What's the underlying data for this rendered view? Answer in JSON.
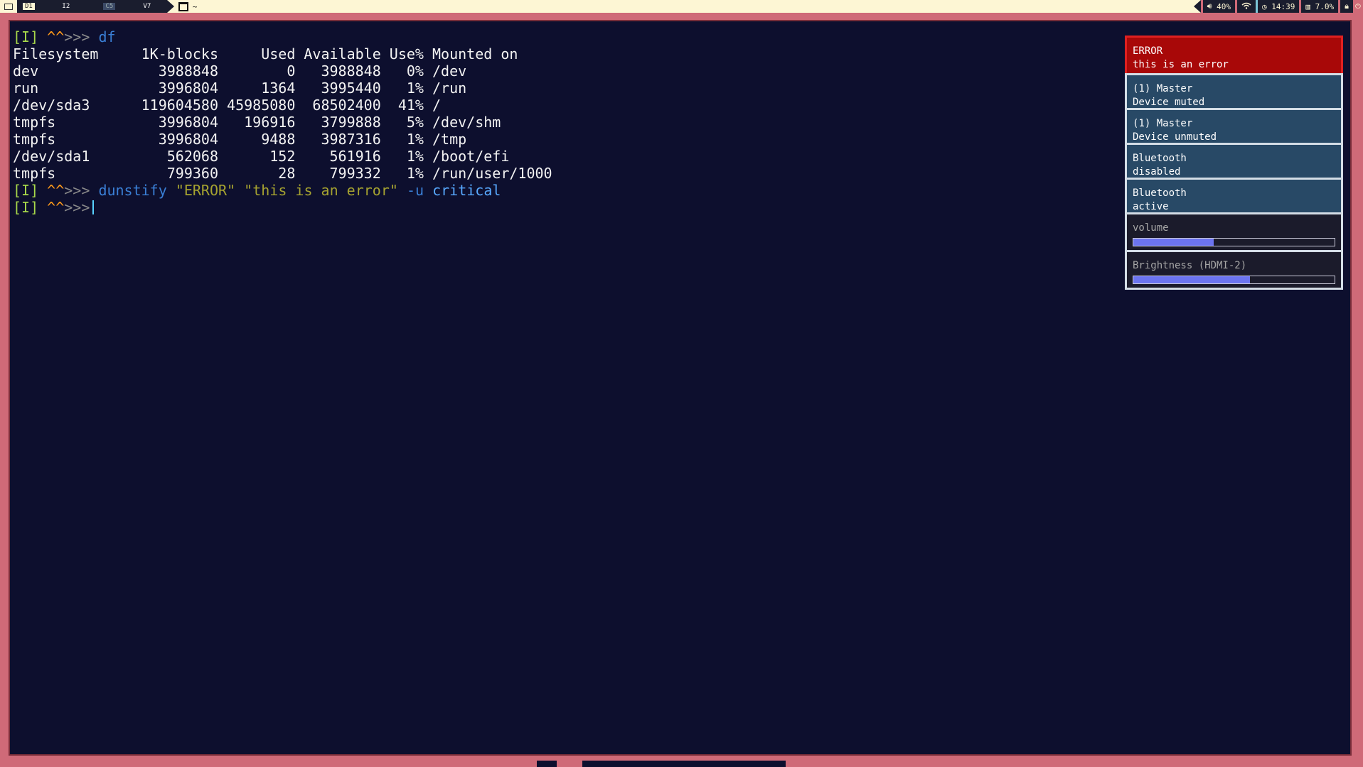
{
  "topbar": {
    "workspaces": [
      {
        "label": "D1",
        "active": true
      },
      {
        "label": "I2",
        "active": false
      },
      {
        "label": "C5",
        "active": false
      },
      {
        "label": "V7",
        "active": false
      }
    ],
    "window_title": "~",
    "status": {
      "volume": "40%",
      "time": "14:39",
      "cpu": "7.0%"
    },
    "icons": {
      "layout": "layout-icon",
      "window": "window-icon",
      "volume": "speaker-icon",
      "wifi": "wifi-icon",
      "clock": "clock-icon",
      "cpu": "cpu-icon",
      "lock": "lock-icon",
      "power": "power-icon"
    }
  },
  "terminal": {
    "prompt": {
      "mode": "[I]",
      "carets": "^^",
      "arrows": ">>>"
    },
    "command1": "df",
    "df": {
      "header": "Filesystem     1K-blocks     Used Available Use% Mounted on",
      "rows": [
        "dev              3988848        0   3988848   0% /dev",
        "run              3996804     1364   3995440   1% /run",
        "/dev/sda3      119604580 45985080  68502400  41% /",
        "tmpfs            3996804   196916   3799888   5% /dev/shm",
        "tmpfs            3996804     9488   3987316   1% /tmp",
        "/dev/sda1         562068      152    561916   1% /boot/efi",
        "tmpfs             799360       28    799332   1% /run/user/1000"
      ]
    },
    "command2": {
      "cmd": "dunstify",
      "arg1": "\"ERROR\"",
      "arg2": "\"this is an error\"",
      "flag": "-u",
      "value": "critical"
    }
  },
  "notifications": [
    {
      "urgency": "critical",
      "summary": "ERROR",
      "body": "this is an error"
    },
    {
      "urgency": "normal",
      "summary": "(1) Master",
      "body": "Device muted"
    },
    {
      "urgency": "normal",
      "summary": "(1) Master",
      "body": "Device unmuted"
    },
    {
      "urgency": "normal",
      "summary": "Bluetooth",
      "body": "disabled"
    },
    {
      "urgency": "normal",
      "summary": "Bluetooth",
      "body": "active"
    },
    {
      "urgency": "low",
      "summary": "volume",
      "progress": 0.4
    },
    {
      "urgency": "low",
      "summary": "Brightness (HDMI-2)",
      "progress": 0.58
    }
  ],
  "colors": {
    "background": "#0d0f2e",
    "frame": "#cf6a78",
    "critical": "#a80808",
    "normal": "#284966",
    "low": "#1b1b2b",
    "progress": "#6c74f0"
  }
}
